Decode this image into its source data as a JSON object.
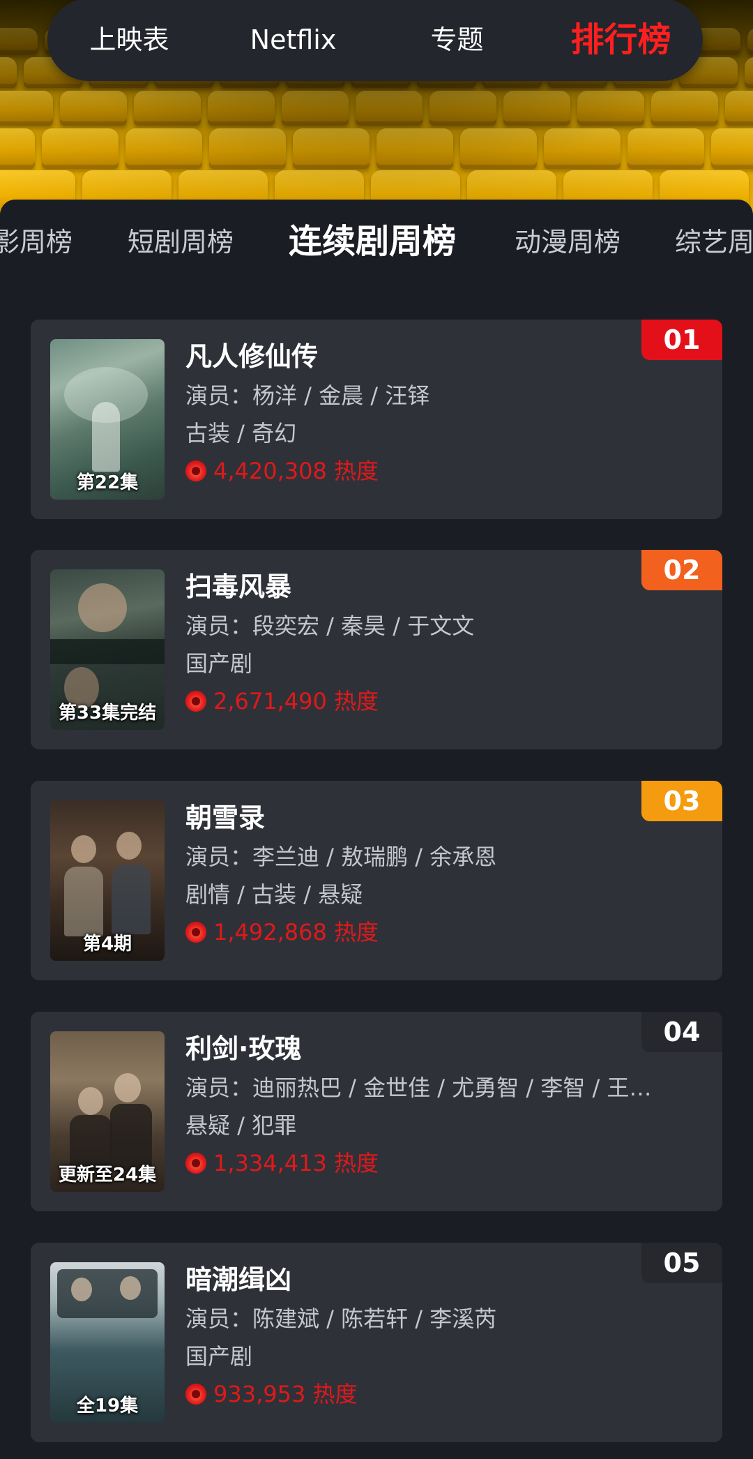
{
  "top_nav": {
    "items": [
      {
        "label": "上映表"
      },
      {
        "label": "Netflix"
      },
      {
        "label": "专题"
      },
      {
        "label": "排行榜"
      }
    ],
    "active": "排行榜"
  },
  "category_tabs": {
    "items": [
      {
        "label": "影周榜"
      },
      {
        "label": "短剧周榜"
      },
      {
        "label": "连续剧周榜"
      },
      {
        "label": "动漫周榜"
      },
      {
        "label": "综艺周"
      }
    ],
    "active": "连续剧周榜"
  },
  "rankings": [
    {
      "rank": "01",
      "rank_color": "#e3101a",
      "title": "凡人修仙传",
      "cast": "演员：杨洋 / 金晨 / 汪铎",
      "genre": "古装 / 奇幻",
      "heat": "4,420,308 热度",
      "poster_caption": "第22集"
    },
    {
      "rank": "02",
      "rank_color": "#f2611d",
      "title": "扫毒风暴",
      "cast": "演员：段奕宏 / 秦昊 / 于文文",
      "genre": "国产剧",
      "heat": "2,671,490 热度",
      "poster_caption": "第33集完结"
    },
    {
      "rank": "03",
      "rank_color": "#f59b0f",
      "title": "朝雪录",
      "cast": "演员：李兰迪 / 敖瑞鹏 / 余承恩",
      "genre": "剧情 / 古装 / 悬疑",
      "heat": "1,492,868 热度",
      "poster_caption": "第4期"
    },
    {
      "rank": "04",
      "rank_color": "#26282e",
      "title": "利剑·玫瑰",
      "cast": "演员：迪丽热巴 / 金世佳 / 尤勇智 / 李智 / 王…",
      "genre": "悬疑 / 犯罪",
      "heat": "1,334,413 热度",
      "poster_caption": "更新至24集"
    },
    {
      "rank": "05",
      "rank_color": "#26282e",
      "title": "暗潮缉凶",
      "cast": "演员：陈建斌 / 陈若轩 / 李溪芮",
      "genre": "国产剧",
      "heat": "933,953 热度",
      "poster_caption": "全19集"
    }
  ],
  "colors": {
    "accent": "#ff1f1f",
    "heat": "#e01919",
    "card_bg": "#2f3139"
  },
  "icons": {
    "heat": "flame-icon"
  }
}
